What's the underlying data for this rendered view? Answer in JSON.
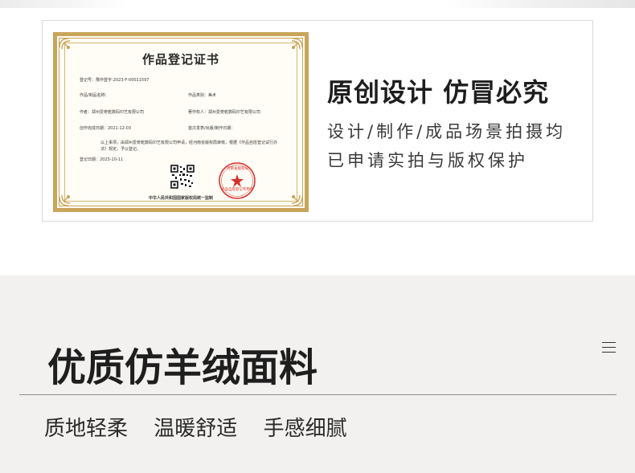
{
  "certificate": {
    "title": "作品登记证书",
    "reg_no": "登记号：豫作登字-2023-F-00011597",
    "work_name": "作品/制品名称：",
    "work_type": "作品类别：美术",
    "author": "作者：郑州爱奇乾数码印艺有限公司",
    "copyright_owner": "著作权人：郑州爱奇乾数码印艺有限公司",
    "creation_date": "创作完成日期：2021-12-03",
    "publish_date": "首次发表/出版/制作日期：",
    "body": "以上事项，由郑州爱奇乾数码印艺有限公司申请，经河南省版权局审核，根据《作品自愿登记试行办法》规定，予以登记。",
    "reg_date": "登记日期：2023-10-11",
    "seal_top": "河南省版权局",
    "seal_bottom": "作品自愿登记专用章",
    "footer": "中华人民共和国国家版权局统一监制"
  },
  "promo": {
    "title": "原创设计 仿冒必究",
    "line1": "设计/制作/成品场景拍摄均",
    "line2": "已申请实拍与版权保护"
  },
  "section": {
    "title": "优质仿羊绒面料",
    "features": [
      "质地轻柔",
      "温暖舒适",
      "手感细腻"
    ]
  },
  "colors": {
    "gold": "#c8a55a",
    "seal_red": "#d8312d",
    "section_bg": "#f2f1ef"
  },
  "icons": {
    "menu": "hamburger-menu-icon"
  }
}
